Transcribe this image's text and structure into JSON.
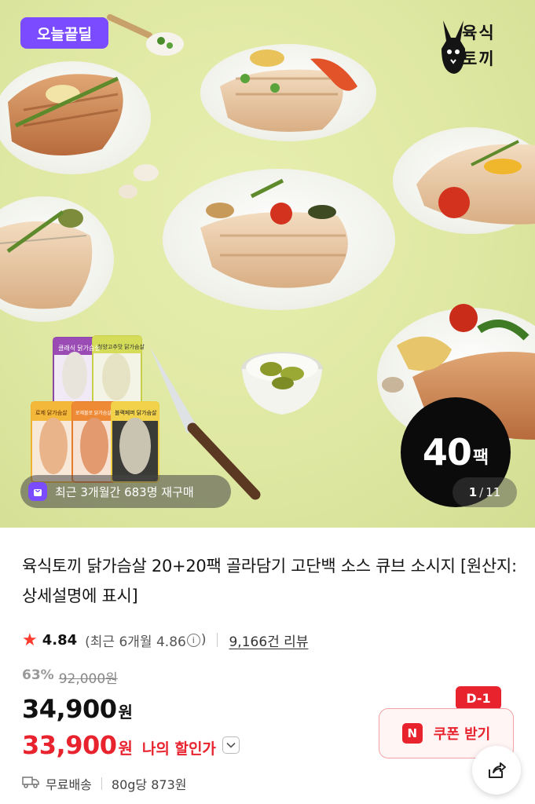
{
  "hero": {
    "deal_badge": "오늘끝딜",
    "brand_logo_text": "육식\n토끼",
    "pack_count": "40",
    "pack_unit": "팩",
    "rebuy_text": "최근 3개월간 683명 재구매",
    "pager": {
      "current": "1",
      "separator": "/",
      "total": "11"
    },
    "package_labels": [
      "클래식 닭가슴살",
      "청양고추맛 닭가슴살",
      "로제 닭가슴살",
      "로제볼로 닭가슴살",
      "블랙페퍼 닭가슴살"
    ]
  },
  "product": {
    "title": "육식토끼 닭가슴살 20+20팩 골라담기 고단백 소스 큐브 소시지 [원산지:상세설명에 표시]"
  },
  "rating": {
    "score": "4.84",
    "recent_prefix": "(최근 6개월 4.86",
    "recent_suffix": ")",
    "reviews": "9,166건 리뷰"
  },
  "pricing": {
    "discount_percent": "63%",
    "original_price": "92,000원",
    "price_amount": "34,900",
    "price_unit": "원",
    "my_price_amount": "33,900",
    "my_price_unit": "원",
    "my_price_label": "나의 할인가"
  },
  "coupon": {
    "dday": "D-1",
    "icon_letter": "N",
    "label": "쿠폰 받기"
  },
  "shipping": {
    "label": "무료배송",
    "unit_price": "80g당 873원"
  },
  "colors": {
    "accent_red": "#e8232e",
    "deal_purple": "#7b4bff",
    "hero_background": "#dfe8a2"
  }
}
